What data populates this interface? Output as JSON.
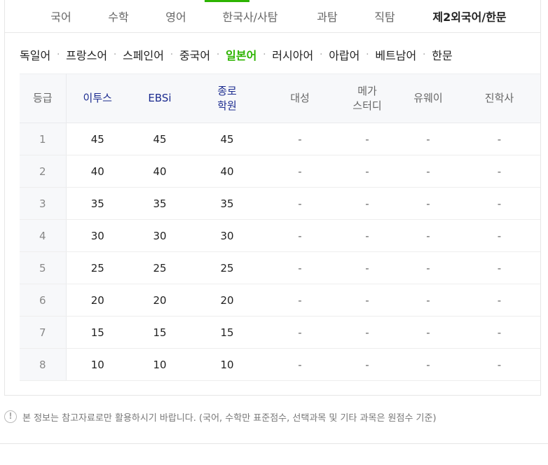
{
  "tabs": [
    {
      "label": "국어"
    },
    {
      "label": "수학"
    },
    {
      "label": "영어"
    },
    {
      "label": "한국사/사탐"
    },
    {
      "label": "과탐"
    },
    {
      "label": "직탐"
    },
    {
      "label": "제2외국어/한문"
    }
  ],
  "selected_tab": "제2외국어/한문",
  "subtabs": [
    {
      "label": "독일어"
    },
    {
      "label": "프랑스어"
    },
    {
      "label": "스페인어"
    },
    {
      "label": "중국어"
    },
    {
      "label": "일본어"
    },
    {
      "label": "러시아어"
    },
    {
      "label": "아랍어"
    },
    {
      "label": "베트남어"
    },
    {
      "label": "한문"
    }
  ],
  "active_subtab": "일본어",
  "table": {
    "headers": [
      {
        "line1": "등급",
        "line2": ""
      },
      {
        "line1": "이투스",
        "line2": ""
      },
      {
        "line1": "EBSi",
        "line2": ""
      },
      {
        "line1": "종로",
        "line2": "학원"
      },
      {
        "line1": "대성",
        "line2": ""
      },
      {
        "line1": "메가",
        "line2": "스터디"
      },
      {
        "line1": "유웨이",
        "line2": ""
      },
      {
        "line1": "진학사",
        "line2": ""
      }
    ],
    "rows": [
      [
        "1",
        "45",
        "45",
        "45",
        "-",
        "-",
        "-",
        "-"
      ],
      [
        "2",
        "40",
        "40",
        "40",
        "-",
        "-",
        "-",
        "-"
      ],
      [
        "3",
        "35",
        "35",
        "35",
        "-",
        "-",
        "-",
        "-"
      ],
      [
        "4",
        "30",
        "30",
        "30",
        "-",
        "-",
        "-",
        "-"
      ],
      [
        "5",
        "25",
        "25",
        "25",
        "-",
        "-",
        "-",
        "-"
      ],
      [
        "6",
        "20",
        "20",
        "20",
        "-",
        "-",
        "-",
        "-"
      ],
      [
        "7",
        "15",
        "15",
        "15",
        "-",
        "-",
        "-",
        "-"
      ],
      [
        "8",
        "10",
        "10",
        "10",
        "-",
        "-",
        "-",
        "-"
      ]
    ]
  },
  "notice": {
    "icon": "exclamation-circle-icon",
    "text": "본 정보는 참고자료로만 활용하시기 바랍니다. (국어, 수학만 표준점수, 선택과목 및 기타 과목은 원점수 기준)"
  },
  "colors": {
    "accent_green": "#2db400",
    "header_blue": "#1b2b8f",
    "header_bg": "#f7f8fa"
  }
}
